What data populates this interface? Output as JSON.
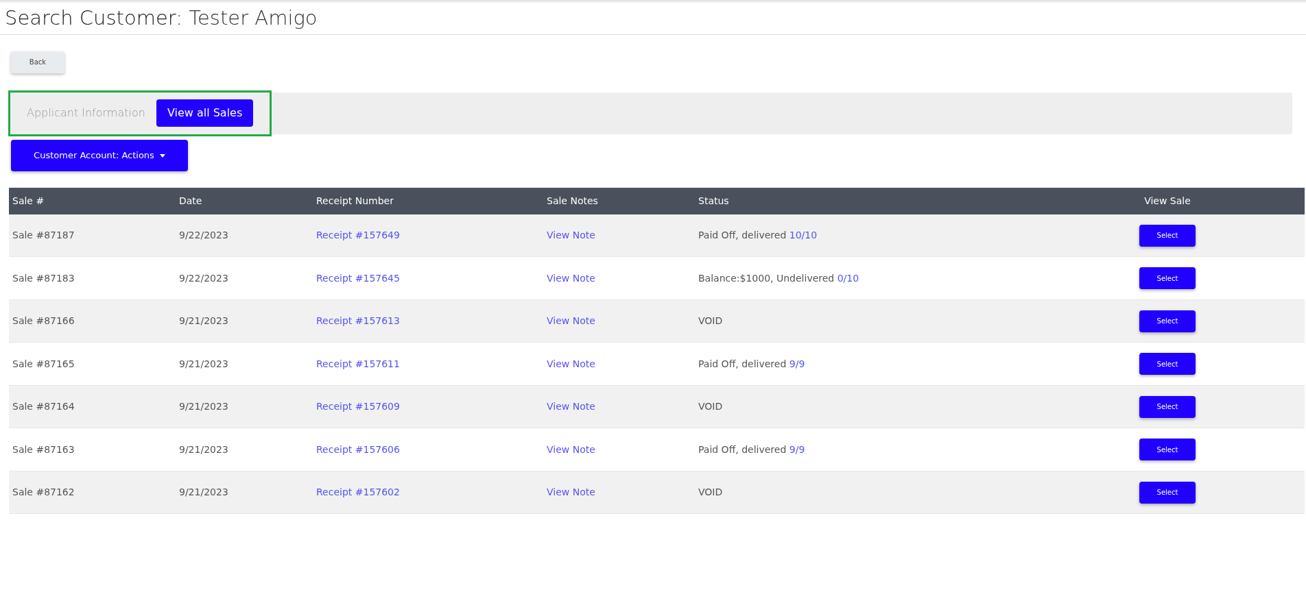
{
  "title": {
    "label": "Search Customer:",
    "name": "Tester Amigo"
  },
  "back_button": "Back",
  "applicant_bar": {
    "label": "Applicant Information",
    "button": "View all Sales",
    "highlighted": true
  },
  "actions_button": "Customer Account: Actions",
  "table": {
    "columns": [
      "Sale #",
      "Date",
      "Receipt Number",
      "Sale Notes",
      "Status",
      "View Sale"
    ],
    "rows": [
      {
        "sale": "Sale #87187",
        "date": "9/22/2023",
        "receipt": "Receipt #157649",
        "note": "View Note",
        "status": "Paid Off, delivered",
        "status_link": "10/10",
        "action": "Select"
      },
      {
        "sale": "Sale #87183",
        "date": "9/22/2023",
        "receipt": "Receipt #157645",
        "note": "View Note",
        "status": "Balance:$1000, Undelivered",
        "status_link": "0/10",
        "action": "Select"
      },
      {
        "sale": "Sale #87166",
        "date": "9/21/2023",
        "receipt": "Receipt #157613",
        "note": "View Note",
        "status": "VOID",
        "action": "Select"
      },
      {
        "sale": "Sale #87165",
        "date": "9/21/2023",
        "receipt": "Receipt #157611",
        "note": "View Note",
        "status": "Paid Off, delivered",
        "status_link": "9/9",
        "action": "Select"
      },
      {
        "sale": "Sale #87164",
        "date": "9/21/2023",
        "receipt": "Receipt #157609",
        "note": "View Note",
        "status": "VOID",
        "action": "Select"
      },
      {
        "sale": "Sale #87163",
        "date": "9/21/2023",
        "receipt": "Receipt #157606",
        "note": "View Note",
        "status": "Paid Off, delivered",
        "status_link": "9/9",
        "action": "Select"
      },
      {
        "sale": "Sale #87162",
        "date": "9/21/2023",
        "receipt": "Receipt #157602",
        "note": "View Note",
        "status": "VOID",
        "action": "Select"
      }
    ]
  }
}
